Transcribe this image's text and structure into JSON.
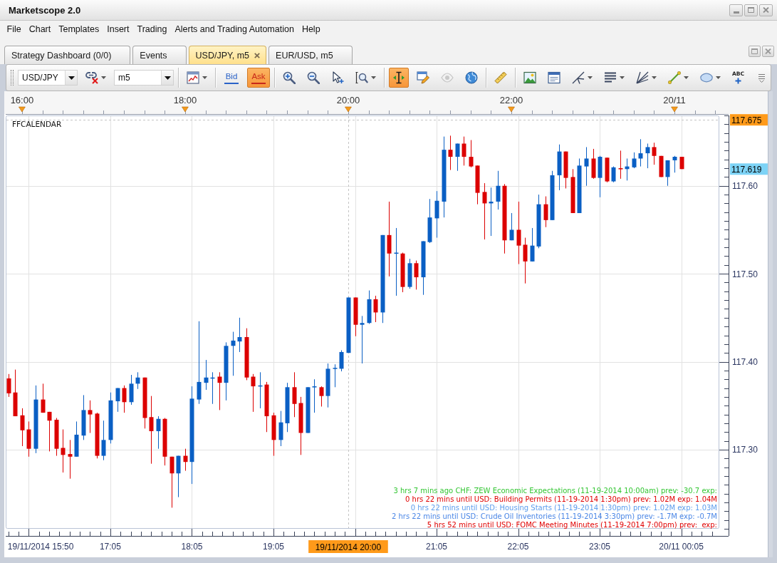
{
  "window": {
    "title": "Marketscope 2.0"
  },
  "menu": [
    "File",
    "Chart",
    "Templates",
    "Insert",
    "Trading",
    "Alerts and Trading Automation",
    "Help"
  ],
  "tabs": [
    {
      "label": "Strategy Dashboard (0/0)",
      "selected": false,
      "closable": false
    },
    {
      "label": "Events",
      "selected": false,
      "closable": false
    },
    {
      "label": "USD/JPY, m5",
      "selected": true,
      "closable": true
    },
    {
      "label": "EUR/USD, m5",
      "selected": false,
      "closable": false
    }
  ],
  "toolbar": [
    {
      "kind": "dropdown",
      "value": "USD/JPY"
    },
    {
      "kind": "tool",
      "selected": false,
      "disabled": false,
      "dropdown": true
    },
    {
      "kind": "dropdown",
      "value": "m5"
    },
    {
      "kind": "separator"
    },
    {
      "kind": "tool",
      "selected": false,
      "disabled": false,
      "dropdown": true
    },
    {
      "kind": "separator"
    },
    {
      "kind": "toggle",
      "label": "Bid",
      "selected": false,
      "color": "#2a62c8"
    },
    {
      "kind": "toggle",
      "label": "Ask",
      "selected": true,
      "color": "#c8281a"
    },
    {
      "kind": "separator"
    },
    {
      "kind": "tool",
      "selected": false,
      "disabled": false,
      "dropdown": false
    },
    {
      "kind": "tool",
      "selected": false,
      "disabled": false,
      "dropdown": false
    },
    {
      "kind": "tool",
      "selected": false,
      "disabled": false,
      "dropdown": false
    },
    {
      "kind": "tool",
      "selected": false,
      "disabled": false,
      "dropdown": true
    },
    {
      "kind": "separator"
    },
    {
      "kind": "tool",
      "selected": true,
      "disabled": false,
      "dropdown": false
    },
    {
      "kind": "tool",
      "selected": false,
      "disabled": false,
      "dropdown": false
    },
    {
      "kind": "tool",
      "selected": false,
      "disabled": true,
      "dropdown": false
    },
    {
      "kind": "tool",
      "selected": false,
      "disabled": false,
      "dropdown": false
    },
    {
      "kind": "separator"
    },
    {
      "kind": "tool",
      "selected": false,
      "disabled": false,
      "dropdown": false
    },
    {
      "kind": "separator"
    },
    {
      "kind": "tool",
      "selected": false,
      "disabled": false,
      "dropdown": false
    },
    {
      "kind": "tool",
      "selected": false,
      "disabled": false,
      "dropdown": false
    },
    {
      "kind": "tool",
      "selected": false,
      "disabled": false,
      "dropdown": true
    },
    {
      "kind": "tool",
      "selected": false,
      "disabled": false,
      "dropdown": true
    },
    {
      "kind": "tool",
      "selected": false,
      "disabled": false,
      "dropdown": true
    },
    {
      "kind": "tool",
      "selected": false,
      "disabled": false,
      "dropdown": true
    },
    {
      "kind": "tool",
      "selected": false,
      "disabled": false,
      "dropdown": true
    },
    {
      "kind": "tool",
      "label": "ABC",
      "selected": false,
      "disabled": false,
      "dropdown": false
    }
  ],
  "chart": {
    "indicator_label": "FFCALENDAR",
    "time_ruler": [
      "16:00",
      "18:00",
      "20:00",
      "22:00",
      "20/11"
    ],
    "current_price": {
      "label": "117.619",
      "color": "#7dd3f6"
    },
    "news": [
      {
        "text": "3 hrs 7 mins ago CHF: ZEW Economic Expectations (11-19-2014 10:00am) prev: -30.7 exp:",
        "color": "#33c633"
      },
      {
        "text": "0 hrs 22 mins until USD: Building Permits (11-19-2014 1:30pm) prev: 1.02M exp: 1.04M",
        "color": "#e00000"
      },
      {
        "text": "0 hrs 22 mins until USD: Housing Starts (11-19-2014 1:30pm) prev: 1.02M exp: 1.03M",
        "color": "#5c9ded"
      },
      {
        "text": "2 hrs 22 mins until USD: Crude Oil Inventories (11-19-2014 3:30pm) prev: -1.7M exp: -0.7M",
        "color": "#4a86e6"
      },
      {
        "text": "5 hrs 52 mins until USD: FOMC Meeting Minutes (11-19-2014 7:00pm) prev:  exp:",
        "color": "#e00000"
      }
    ],
    "chart_data": [
      {
        "type": "candlestick",
        "x": [
          "2014-11-19T15:50",
          "2014-11-19T15:55",
          "2014-11-19T16:00",
          "2014-11-19T16:05",
          "2014-11-19T16:10",
          "2014-11-19T16:15",
          "2014-11-19T16:20",
          "2014-11-19T16:25",
          "2014-11-19T16:30",
          "2014-11-19T16:35",
          "2014-11-19T16:40",
          "2014-11-19T16:45",
          "2014-11-19T16:50",
          "2014-11-19T16:55",
          "2014-11-19T17:00",
          "2014-11-19T17:05",
          "2014-11-19T17:10",
          "2014-11-19T17:15",
          "2014-11-19T17:20",
          "2014-11-19T17:25",
          "2014-11-19T17:30",
          "2014-11-19T17:35",
          "2014-11-19T17:40",
          "2014-11-19T17:45",
          "2014-11-19T17:50",
          "2014-11-19T17:55",
          "2014-11-19T18:00",
          "2014-11-19T18:05",
          "2014-11-19T18:10",
          "2014-11-19T18:15",
          "2014-11-19T18:20",
          "2014-11-19T18:25",
          "2014-11-19T18:30",
          "2014-11-19T18:35",
          "2014-11-19T18:40",
          "2014-11-19T18:45",
          "2014-11-19T18:50",
          "2014-11-19T18:55",
          "2014-11-19T19:00",
          "2014-11-19T19:05",
          "2014-11-19T19:10",
          "2014-11-19T19:15",
          "2014-11-19T19:20",
          "2014-11-19T19:25",
          "2014-11-19T19:30",
          "2014-11-19T19:35",
          "2014-11-19T19:40",
          "2014-11-19T19:45",
          "2014-11-19T19:50",
          "2014-11-19T19:55",
          "2014-11-19T20:00",
          "2014-11-19T20:05",
          "2014-11-19T20:10",
          "2014-11-19T20:15",
          "2014-11-19T20:20",
          "2014-11-19T20:25",
          "2014-11-19T20:30",
          "2014-11-19T20:35",
          "2014-11-19T20:40",
          "2014-11-19T20:45",
          "2014-11-19T20:50",
          "2014-11-19T20:55",
          "2014-11-19T21:00",
          "2014-11-19T21:05",
          "2014-11-19T21:10",
          "2014-11-19T21:15",
          "2014-11-19T21:20",
          "2014-11-19T21:25",
          "2014-11-19T21:30",
          "2014-11-19T21:35",
          "2014-11-19T21:40",
          "2014-11-19T21:45",
          "2014-11-19T21:50",
          "2014-11-19T21:55",
          "2014-11-19T22:00",
          "2014-11-19T22:05",
          "2014-11-19T22:10",
          "2014-11-19T22:15",
          "2014-11-19T22:20",
          "2014-11-19T22:25",
          "2014-11-19T22:30",
          "2014-11-19T22:35",
          "2014-11-19T22:40",
          "2014-11-19T22:45",
          "2014-11-19T22:50",
          "2014-11-19T22:55",
          "2014-11-19T23:00",
          "2014-11-19T23:05",
          "2014-11-19T23:10",
          "2014-11-19T23:15",
          "2014-11-19T23:20",
          "2014-11-19T23:25",
          "2014-11-19T23:30",
          "2014-11-19T23:35",
          "2014-11-19T23:40",
          "2014-11-19T23:45",
          "2014-11-19T23:50",
          "2014-11-19T23:55",
          "2014-11-20T00:00",
          "2014-11-20T00:05"
        ],
        "ohlc": [
          [
            117.381,
            117.386,
            117.36,
            117.364
          ],
          [
            117.365,
            117.391,
            117.338,
            117.338
          ],
          [
            117.339,
            117.347,
            117.304,
            117.322
          ],
          [
            117.323,
            117.332,
            117.292,
            117.301
          ],
          [
            117.301,
            117.373,
            117.296,
            117.357
          ],
          [
            117.357,
            117.375,
            117.342,
            117.342
          ],
          [
            117.343,
            117.343,
            117.298,
            117.333
          ],
          [
            117.334,
            117.336,
            117.293,
            117.301
          ],
          [
            117.302,
            117.323,
            117.274,
            117.294
          ],
          [
            117.295,
            117.311,
            117.267,
            117.292
          ],
          [
            117.292,
            117.332,
            117.292,
            117.317
          ],
          [
            117.316,
            117.362,
            117.311,
            117.345
          ],
          [
            117.345,
            117.356,
            117.319,
            117.34
          ],
          [
            117.341,
            117.342,
            117.29,
            117.293
          ],
          [
            117.293,
            117.333,
            117.288,
            117.311
          ],
          [
            117.311,
            117.365,
            117.307,
            117.356
          ],
          [
            117.355,
            117.37,
            117.343,
            117.37
          ],
          [
            117.37,
            117.373,
            117.342,
            117.354
          ],
          [
            117.354,
            117.385,
            117.351,
            117.375
          ],
          [
            117.375,
            117.388,
            117.369,
            117.382
          ],
          [
            117.382,
            117.382,
            117.324,
            117.336
          ],
          [
            117.337,
            117.361,
            117.284,
            117.321
          ],
          [
            117.321,
            117.338,
            117.301,
            117.335
          ],
          [
            117.335,
            117.336,
            117.282,
            117.292
          ],
          [
            117.292,
            117.292,
            117.234,
            117.273
          ],
          [
            117.273,
            117.293,
            117.246,
            117.293
          ],
          [
            117.293,
            117.301,
            117.276,
            117.286
          ],
          [
            117.286,
            117.372,
            117.261,
            117.358
          ],
          [
            117.357,
            117.446,
            117.352,
            117.377
          ],
          [
            117.376,
            117.402,
            117.368,
            117.382
          ],
          [
            117.381,
            117.388,
            117.352,
            117.382
          ],
          [
            117.383,
            117.388,
            117.345,
            117.376
          ],
          [
            117.376,
            117.422,
            117.356,
            117.418
          ],
          [
            117.418,
            117.434,
            117.384,
            117.424
          ],
          [
            117.423,
            117.45,
            117.411,
            117.428
          ],
          [
            117.428,
            117.438,
            117.379,
            117.382
          ],
          [
            117.383,
            117.386,
            117.343,
            117.372
          ],
          [
            117.372,
            117.388,
            117.347,
            117.373
          ],
          [
            117.374,
            117.377,
            117.32,
            117.338
          ],
          [
            117.339,
            117.342,
            117.293,
            117.311
          ],
          [
            117.311,
            117.344,
            117.304,
            117.331
          ],
          [
            117.33,
            117.376,
            117.32,
            117.371
          ],
          [
            117.371,
            117.388,
            117.337,
            117.352
          ],
          [
            117.353,
            117.36,
            117.294,
            117.319
          ],
          [
            117.319,
            117.371,
            117.319,
            117.371
          ],
          [
            117.371,
            117.38,
            117.342,
            117.372
          ],
          [
            117.371,
            117.372,
            117.349,
            117.361
          ],
          [
            117.361,
            117.398,
            117.348,
            117.392
          ],
          [
            117.392,
            117.397,
            117.371,
            117.393
          ],
          [
            117.392,
            117.413,
            117.389,
            117.411
          ],
          [
            117.41,
            117.473,
            117.41,
            117.473
          ],
          [
            117.473,
            117.473,
            117.429,
            117.442
          ],
          [
            117.442,
            117.452,
            117.398,
            117.444
          ],
          [
            117.444,
            117.481,
            117.443,
            117.471
          ],
          [
            117.471,
            117.475,
            117.445,
            117.456
          ],
          [
            117.456,
            117.544,
            117.444,
            117.544
          ],
          [
            117.544,
            117.582,
            117.497,
            117.523
          ],
          [
            117.523,
            117.552,
            117.475,
            117.524
          ],
          [
            117.523,
            117.524,
            117.479,
            117.485
          ],
          [
            117.485,
            117.517,
            117.483,
            117.512
          ],
          [
            117.512,
            117.515,
            117.482,
            117.496
          ],
          [
            117.496,
            117.537,
            117.476,
            117.537
          ],
          [
            117.536,
            117.585,
            117.535,
            117.564
          ],
          [
            117.563,
            117.594,
            117.541,
            117.583
          ],
          [
            117.582,
            117.656,
            117.564,
            117.641
          ],
          [
            117.641,
            117.657,
            117.618,
            117.633
          ],
          [
            117.633,
            117.648,
            117.617,
            117.648
          ],
          [
            117.648,
            117.656,
            117.623,
            117.633
          ],
          [
            117.633,
            117.652,
            117.621,
            117.622
          ],
          [
            117.623,
            117.623,
            117.579,
            117.592
          ],
          [
            117.593,
            117.603,
            117.539,
            117.58
          ],
          [
            117.58,
            117.598,
            117.543,
            117.582
          ],
          [
            117.582,
            117.617,
            117.573,
            117.6
          ],
          [
            117.6,
            117.602,
            117.523,
            117.538
          ],
          [
            117.538,
            117.569,
            117.538,
            117.55
          ],
          [
            117.55,
            117.582,
            117.511,
            117.532
          ],
          [
            117.533,
            117.541,
            117.489,
            117.514
          ],
          [
            117.514,
            117.552,
            117.514,
            117.532
          ],
          [
            117.531,
            117.59,
            117.529,
            117.579
          ],
          [
            117.579,
            117.588,
            117.553,
            117.561
          ],
          [
            117.561,
            117.617,
            117.561,
            117.612
          ],
          [
            117.612,
            117.647,
            117.595,
            117.639
          ],
          [
            117.639,
            117.639,
            117.597,
            117.609
          ],
          [
            117.61,
            117.619,
            117.569,
            117.569
          ],
          [
            117.569,
            117.631,
            117.569,
            117.623
          ],
          [
            117.622,
            117.644,
            117.6,
            117.631
          ],
          [
            117.631,
            117.642,
            117.608,
            117.609
          ],
          [
            117.609,
            117.634,
            117.587,
            117.633
          ],
          [
            117.632,
            117.632,
            117.604,
            117.605
          ],
          [
            117.605,
            117.622,
            117.604,
            117.621
          ],
          [
            117.62,
            117.64,
            117.608,
            117.619
          ],
          [
            117.619,
            117.631,
            117.606,
            117.622
          ],
          [
            117.621,
            117.638,
            117.62,
            117.631
          ],
          [
            117.631,
            117.653,
            117.622,
            117.637
          ],
          [
            117.637,
            117.648,
            117.62,
            117.644
          ],
          [
            117.644,
            117.649,
            117.624,
            117.634
          ],
          [
            117.634,
            117.634,
            117.61,
            117.61
          ],
          [
            117.61,
            117.629,
            117.6,
            117.629
          ],
          [
            117.629,
            117.634,
            117.615,
            117.633
          ],
          [
            117.633,
            117.633,
            117.619,
            117.619
          ]
        ],
        "xlim": [
          "2014-11-19T15:48",
          "2014-11-20T00:33"
        ],
        "ylim": [
          117.21,
          117.68
        ],
        "yticks": [
          {
            "value": 117.3,
            "label": "117.30"
          },
          {
            "value": 117.4,
            "label": "117.40"
          },
          {
            "value": 117.5,
            "label": "117.50"
          },
          {
            "value": 117.6,
            "label": "117.60"
          }
        ],
        "xticks": [
          {
            "value": "2014-11-19T15:50",
            "label": "19/11/2014 15:50"
          },
          {
            "value": "2014-11-19T17:05",
            "label": "17:05"
          },
          {
            "value": "2014-11-19T18:05",
            "label": "18:05"
          },
          {
            "value": "2014-11-19T19:05",
            "label": "19:05"
          },
          {
            "value": "2014-11-19T21:05",
            "label": "21:05"
          },
          {
            "value": "2014-11-19T22:05",
            "label": "22:05"
          },
          {
            "value": "2014-11-19T23:05",
            "label": "23:05"
          },
          {
            "value": "2014-11-20T00:05",
            "label": "20/11 00:05"
          }
        ],
        "grid": true,
        "ref_lines": [
          {
            "axis": "y",
            "value": 117.675,
            "label": "117.675",
            "color": "#c4c4c4",
            "line_style": "dashed"
          },
          {
            "axis": "x",
            "value": "2014-11-19T20:00",
            "label": "19/11/2014 20:00",
            "color": "#c4c4c4",
            "line_style": "dashed"
          }
        ]
      }
    ]
  }
}
